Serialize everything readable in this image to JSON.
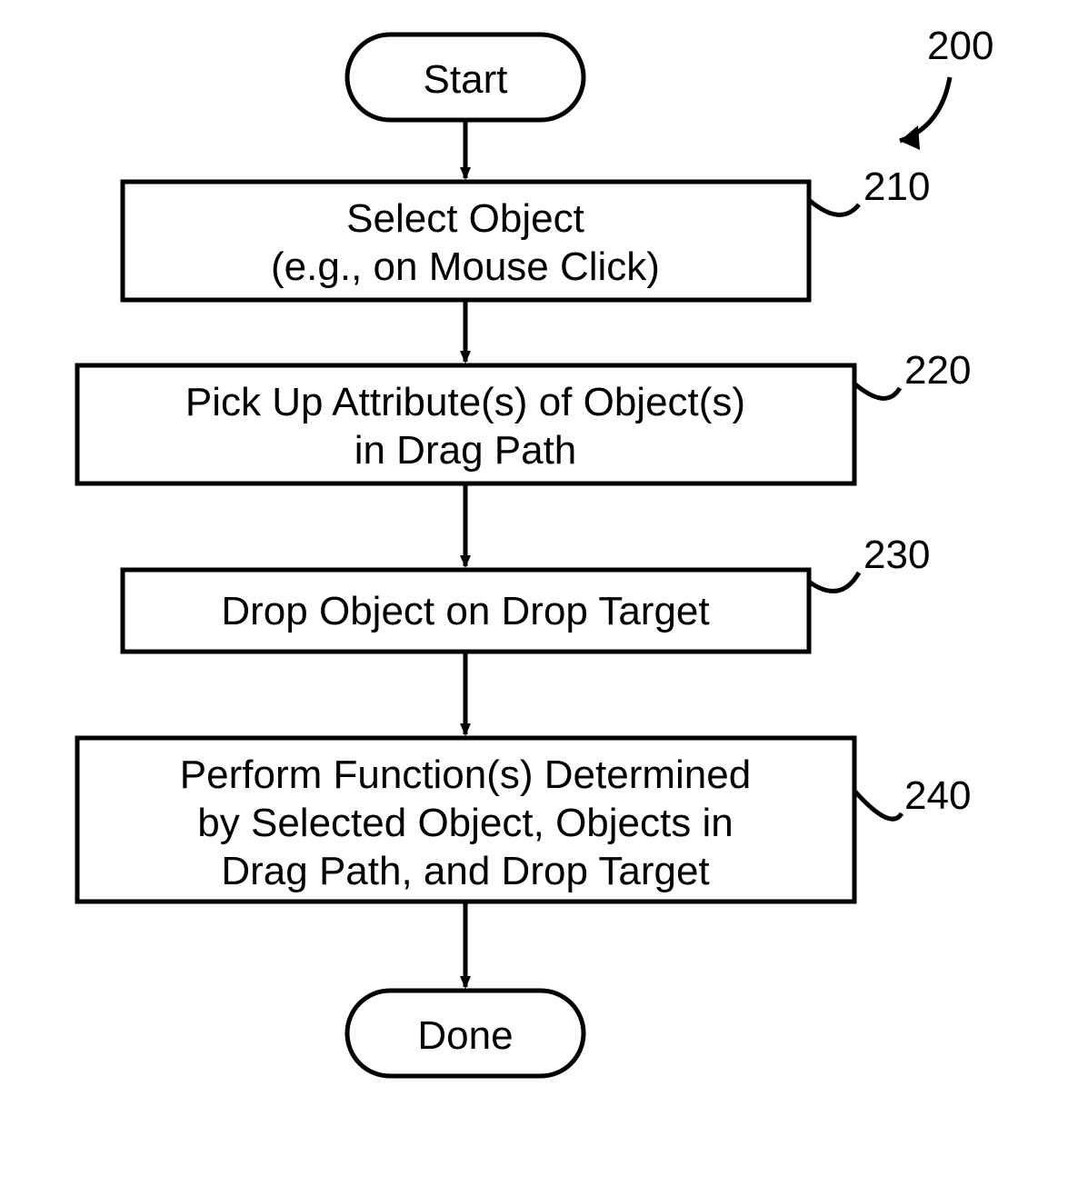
{
  "diagram": {
    "figure_label": "200",
    "start": "Start",
    "done": "Done",
    "steps": [
      {
        "ref": "210",
        "line1": "Select Object",
        "line2": "(e.g., on Mouse Click)",
        "line3": ""
      },
      {
        "ref": "220",
        "line1": "Pick Up Attribute(s) of Object(s)",
        "line2": "in Drag Path",
        "line3": ""
      },
      {
        "ref": "230",
        "line1": "Drop Object on Drop Target",
        "line2": "",
        "line3": ""
      },
      {
        "ref": "240",
        "line1": "Perform Function(s) Determined",
        "line2": "by Selected Object, Objects in",
        "line3": "Drag Path, and Drop Target"
      }
    ]
  }
}
